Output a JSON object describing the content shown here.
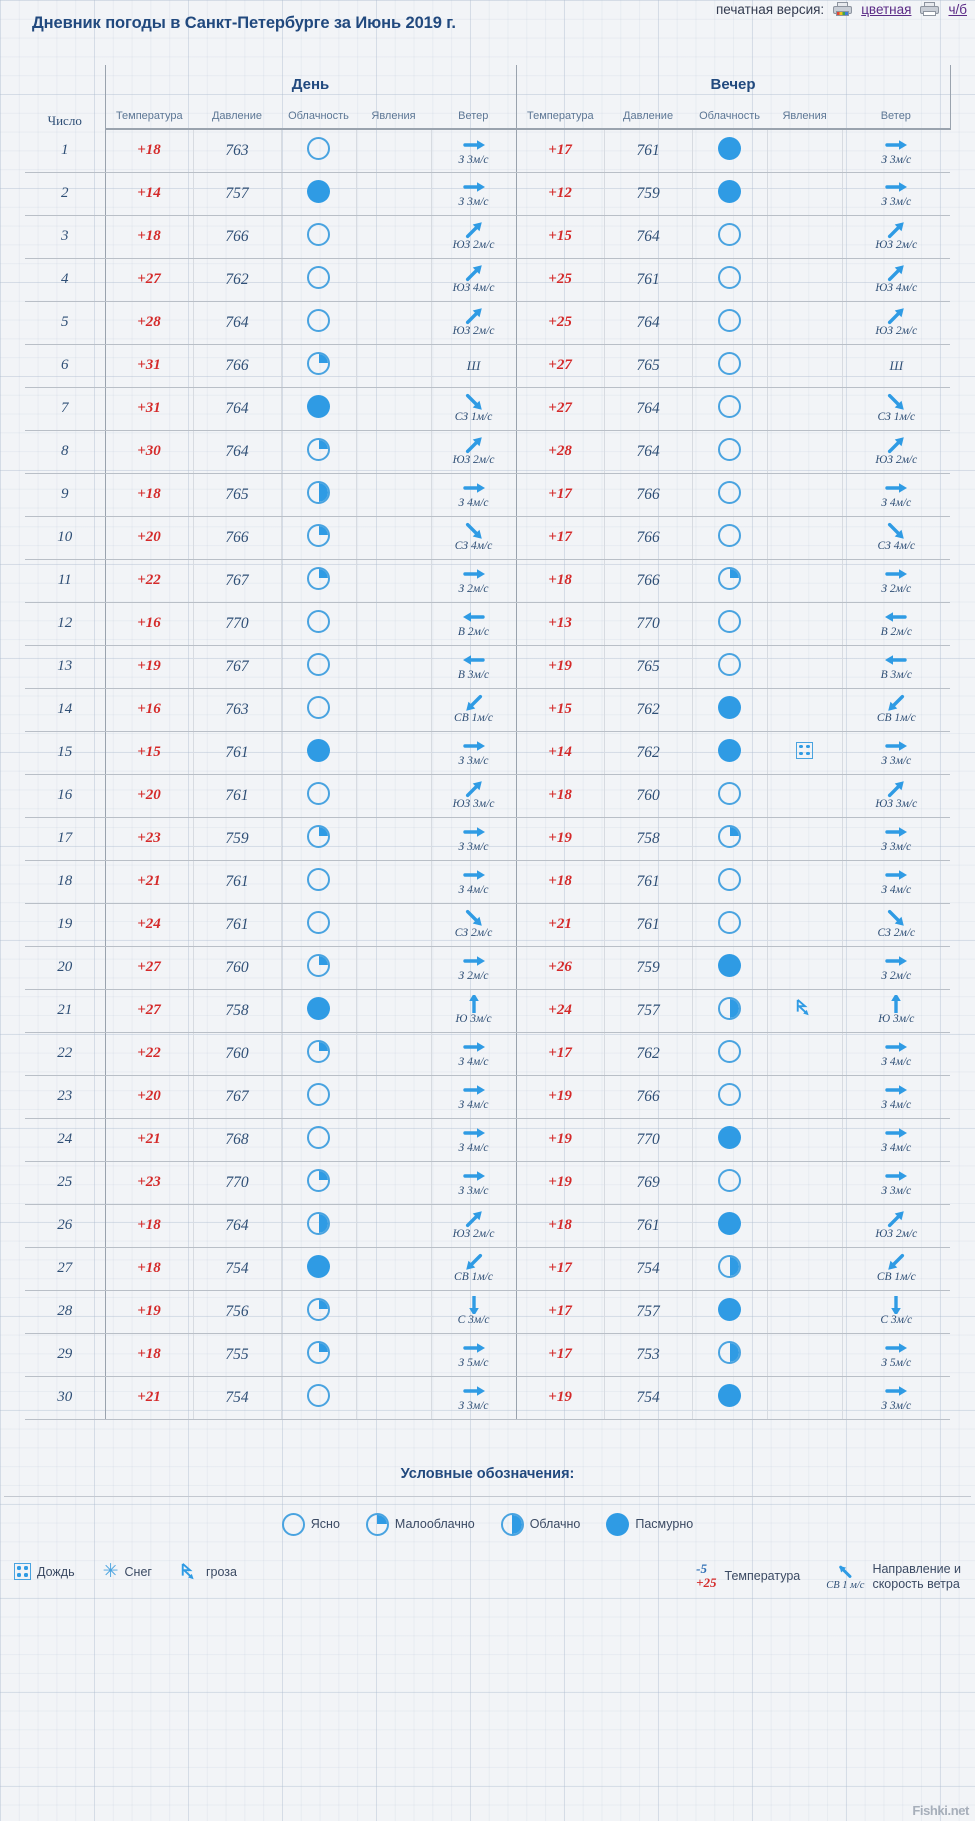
{
  "header": {
    "title": "Дневник погоды в Санкт-Петербурге за Июнь 2019 г.",
    "print_label": "печатная версия:",
    "print_color": "цветная",
    "print_bw": "ч/б"
  },
  "table": {
    "corner": "Число",
    "groups": [
      "День",
      "Вечер"
    ],
    "subheaders": [
      "Температура",
      "Давление",
      "Облачность",
      "Явления",
      "Ветер"
    ],
    "rows": [
      {
        "day": "1",
        "d": {
          "t": "+18",
          "p": "763",
          "cloud": "clear",
          "ph": "",
          "wd": "З",
          "ws": "3",
          "wdir": "E"
        },
        "e": {
          "t": "+17",
          "p": "761",
          "cloud": "overcast",
          "ph": "",
          "wd": "З",
          "ws": "3",
          "wdir": "E"
        }
      },
      {
        "day": "2",
        "d": {
          "t": "+14",
          "p": "757",
          "cloud": "overcast",
          "ph": "",
          "wd": "З",
          "ws": "3",
          "wdir": "E"
        },
        "e": {
          "t": "+12",
          "p": "759",
          "cloud": "overcast",
          "ph": "",
          "wd": "З",
          "ws": "3",
          "wdir": "E"
        }
      },
      {
        "day": "3",
        "d": {
          "t": "+18",
          "p": "766",
          "cloud": "clear",
          "ph": "",
          "wd": "ЮЗ",
          "ws": "2",
          "wdir": "NE"
        },
        "e": {
          "t": "+15",
          "p": "764",
          "cloud": "clear",
          "ph": "",
          "wd": "ЮЗ",
          "ws": "2",
          "wdir": "NE"
        }
      },
      {
        "day": "4",
        "d": {
          "t": "+27",
          "p": "762",
          "cloud": "clear",
          "ph": "",
          "wd": "ЮЗ",
          "ws": "4",
          "wdir": "NE"
        },
        "e": {
          "t": "+25",
          "p": "761",
          "cloud": "clear",
          "ph": "",
          "wd": "ЮЗ",
          "ws": "4",
          "wdir": "NE"
        }
      },
      {
        "day": "5",
        "d": {
          "t": "+28",
          "p": "764",
          "cloud": "clear",
          "ph": "",
          "wd": "ЮЗ",
          "ws": "2",
          "wdir": "NE"
        },
        "e": {
          "t": "+25",
          "p": "764",
          "cloud": "clear",
          "ph": "",
          "wd": "ЮЗ",
          "ws": "2",
          "wdir": "NE"
        }
      },
      {
        "day": "6",
        "d": {
          "t": "+31",
          "p": "766",
          "cloud": "partly",
          "ph": "",
          "wd": "",
          "ws": "",
          "wdir": "calm"
        },
        "e": {
          "t": "+27",
          "p": "765",
          "cloud": "clear",
          "ph": "",
          "wd": "",
          "ws": "",
          "wdir": "calm"
        }
      },
      {
        "day": "7",
        "d": {
          "t": "+31",
          "p": "764",
          "cloud": "overcast",
          "ph": "",
          "wd": "СЗ",
          "ws": "1",
          "wdir": "SE"
        },
        "e": {
          "t": "+27",
          "p": "764",
          "cloud": "clear",
          "ph": "",
          "wd": "СЗ",
          "ws": "1",
          "wdir": "SE"
        }
      },
      {
        "day": "8",
        "d": {
          "t": "+30",
          "p": "764",
          "cloud": "partly",
          "ph": "",
          "wd": "ЮЗ",
          "ws": "2",
          "wdir": "NE"
        },
        "e": {
          "t": "+28",
          "p": "764",
          "cloud": "clear",
          "ph": "",
          "wd": "ЮЗ",
          "ws": "2",
          "wdir": "NE"
        }
      },
      {
        "day": "9",
        "d": {
          "t": "+18",
          "p": "765",
          "cloud": "cloudy",
          "ph": "",
          "wd": "З",
          "ws": "4",
          "wdir": "E"
        },
        "e": {
          "t": "+17",
          "p": "766",
          "cloud": "clear",
          "ph": "",
          "wd": "З",
          "ws": "4",
          "wdir": "E"
        }
      },
      {
        "day": "10",
        "d": {
          "t": "+20",
          "p": "766",
          "cloud": "partly",
          "ph": "",
          "wd": "СЗ",
          "ws": "4",
          "wdir": "SE"
        },
        "e": {
          "t": "+17",
          "p": "766",
          "cloud": "clear",
          "ph": "",
          "wd": "СЗ",
          "ws": "4",
          "wdir": "SE"
        }
      },
      {
        "day": "11",
        "d": {
          "t": "+22",
          "p": "767",
          "cloud": "partly",
          "ph": "",
          "wd": "З",
          "ws": "2",
          "wdir": "E"
        },
        "e": {
          "t": "+18",
          "p": "766",
          "cloud": "partly",
          "ph": "",
          "wd": "З",
          "ws": "2",
          "wdir": "E"
        }
      },
      {
        "day": "12",
        "d": {
          "t": "+16",
          "p": "770",
          "cloud": "clear",
          "ph": "",
          "wd": "В",
          "ws": "2",
          "wdir": "W"
        },
        "e": {
          "t": "+13",
          "p": "770",
          "cloud": "clear",
          "ph": "",
          "wd": "В",
          "ws": "2",
          "wdir": "W"
        }
      },
      {
        "day": "13",
        "d": {
          "t": "+19",
          "p": "767",
          "cloud": "clear",
          "ph": "",
          "wd": "В",
          "ws": "3",
          "wdir": "W"
        },
        "e": {
          "t": "+19",
          "p": "765",
          "cloud": "clear",
          "ph": "",
          "wd": "В",
          "ws": "3",
          "wdir": "W"
        }
      },
      {
        "day": "14",
        "d": {
          "t": "+16",
          "p": "763",
          "cloud": "clear",
          "ph": "",
          "wd": "СВ",
          "ws": "1",
          "wdir": "SW"
        },
        "e": {
          "t": "+15",
          "p": "762",
          "cloud": "overcast",
          "ph": "",
          "wd": "СВ",
          "ws": "1",
          "wdir": "SW"
        }
      },
      {
        "day": "15",
        "d": {
          "t": "+15",
          "p": "761",
          "cloud": "overcast",
          "ph": "",
          "wd": "З",
          "ws": "3",
          "wdir": "E"
        },
        "e": {
          "t": "+14",
          "p": "762",
          "cloud": "overcast",
          "ph": "rain",
          "wd": "З",
          "ws": "3",
          "wdir": "E"
        }
      },
      {
        "day": "16",
        "d": {
          "t": "+20",
          "p": "761",
          "cloud": "clear",
          "ph": "",
          "wd": "ЮЗ",
          "ws": "3",
          "wdir": "NE"
        },
        "e": {
          "t": "+18",
          "p": "760",
          "cloud": "clear",
          "ph": "",
          "wd": "ЮЗ",
          "ws": "3",
          "wdir": "NE"
        }
      },
      {
        "day": "17",
        "d": {
          "t": "+23",
          "p": "759",
          "cloud": "partly",
          "ph": "",
          "wd": "З",
          "ws": "3",
          "wdir": "E"
        },
        "e": {
          "t": "+19",
          "p": "758",
          "cloud": "partly",
          "ph": "",
          "wd": "З",
          "ws": "3",
          "wdir": "E"
        }
      },
      {
        "day": "18",
        "d": {
          "t": "+21",
          "p": "761",
          "cloud": "clear",
          "ph": "",
          "wd": "З",
          "ws": "4",
          "wdir": "E"
        },
        "e": {
          "t": "+18",
          "p": "761",
          "cloud": "clear",
          "ph": "",
          "wd": "З",
          "ws": "4",
          "wdir": "E"
        }
      },
      {
        "day": "19",
        "d": {
          "t": "+24",
          "p": "761",
          "cloud": "clear",
          "ph": "",
          "wd": "СЗ",
          "ws": "2",
          "wdir": "SE"
        },
        "e": {
          "t": "+21",
          "p": "761",
          "cloud": "clear",
          "ph": "",
          "wd": "СЗ",
          "ws": "2",
          "wdir": "SE"
        }
      },
      {
        "day": "20",
        "d": {
          "t": "+27",
          "p": "760",
          "cloud": "partly",
          "ph": "",
          "wd": "З",
          "ws": "2",
          "wdir": "E"
        },
        "e": {
          "t": "+26",
          "p": "759",
          "cloud": "overcast",
          "ph": "",
          "wd": "З",
          "ws": "2",
          "wdir": "E"
        }
      },
      {
        "day": "21",
        "d": {
          "t": "+27",
          "p": "758",
          "cloud": "overcast",
          "ph": "",
          "wd": "Ю",
          "ws": "3",
          "wdir": "N"
        },
        "e": {
          "t": "+24",
          "p": "757",
          "cloud": "cloudy",
          "ph": "storm",
          "wd": "Ю",
          "ws": "3",
          "wdir": "N"
        }
      },
      {
        "day": "22",
        "d": {
          "t": "+22",
          "p": "760",
          "cloud": "partly",
          "ph": "",
          "wd": "З",
          "ws": "4",
          "wdir": "E"
        },
        "e": {
          "t": "+17",
          "p": "762",
          "cloud": "clear",
          "ph": "",
          "wd": "З",
          "ws": "4",
          "wdir": "E"
        }
      },
      {
        "day": "23",
        "d": {
          "t": "+20",
          "p": "767",
          "cloud": "clear",
          "ph": "",
          "wd": "З",
          "ws": "4",
          "wdir": "E"
        },
        "e": {
          "t": "+19",
          "p": "766",
          "cloud": "clear",
          "ph": "",
          "wd": "З",
          "ws": "4",
          "wdir": "E"
        }
      },
      {
        "day": "24",
        "d": {
          "t": "+21",
          "p": "768",
          "cloud": "clear",
          "ph": "",
          "wd": "З",
          "ws": "4",
          "wdir": "E"
        },
        "e": {
          "t": "+19",
          "p": "770",
          "cloud": "overcast",
          "ph": "",
          "wd": "З",
          "ws": "4",
          "wdir": "E"
        }
      },
      {
        "day": "25",
        "d": {
          "t": "+23",
          "p": "770",
          "cloud": "partly",
          "ph": "",
          "wd": "З",
          "ws": "3",
          "wdir": "E"
        },
        "e": {
          "t": "+19",
          "p": "769",
          "cloud": "clear",
          "ph": "",
          "wd": "З",
          "ws": "3",
          "wdir": "E"
        }
      },
      {
        "day": "26",
        "d": {
          "t": "+18",
          "p": "764",
          "cloud": "cloudy",
          "ph": "",
          "wd": "ЮЗ",
          "ws": "2",
          "wdir": "NE"
        },
        "e": {
          "t": "+18",
          "p": "761",
          "cloud": "overcast",
          "ph": "",
          "wd": "ЮЗ",
          "ws": "2",
          "wdir": "NE"
        }
      },
      {
        "day": "27",
        "d": {
          "t": "+18",
          "p": "754",
          "cloud": "overcast",
          "ph": "",
          "wd": "СВ",
          "ws": "1",
          "wdir": "SW"
        },
        "e": {
          "t": "+17",
          "p": "754",
          "cloud": "cloudy",
          "ph": "",
          "wd": "СВ",
          "ws": "1",
          "wdir": "SW"
        }
      },
      {
        "day": "28",
        "d": {
          "t": "+19",
          "p": "756",
          "cloud": "partly",
          "ph": "",
          "wd": "С",
          "ws": "3",
          "wdir": "S"
        },
        "e": {
          "t": "+17",
          "p": "757",
          "cloud": "overcast",
          "ph": "",
          "wd": "С",
          "ws": "3",
          "wdir": "S"
        }
      },
      {
        "day": "29",
        "d": {
          "t": "+18",
          "p": "755",
          "cloud": "partly",
          "ph": "",
          "wd": "З",
          "ws": "5",
          "wdir": "E"
        },
        "e": {
          "t": "+17",
          "p": "753",
          "cloud": "cloudy",
          "ph": "",
          "wd": "З",
          "ws": "5",
          "wdir": "E"
        }
      },
      {
        "day": "30",
        "d": {
          "t": "+21",
          "p": "754",
          "cloud": "clear",
          "ph": "",
          "wd": "З",
          "ws": "3",
          "wdir": "E"
        },
        "e": {
          "t": "+19",
          "p": "754",
          "cloud": "overcast",
          "ph": "",
          "wd": "З",
          "ws": "3",
          "wdir": "E"
        }
      }
    ]
  },
  "legend": {
    "title": "Условные обозначения:",
    "cloud_items": [
      {
        "key": "clear",
        "label": "Ясно"
      },
      {
        "key": "partly",
        "label": "Малооблачно"
      },
      {
        "key": "cloudy",
        "label": "Облачно"
      },
      {
        "key": "overcast",
        "label": "Пасмурно"
      }
    ],
    "phenomena": [
      {
        "key": "rain",
        "label": "Дождь"
      },
      {
        "key": "snow",
        "label": "Снег"
      },
      {
        "key": "storm",
        "label": "гроза"
      }
    ],
    "temp_key": {
      "cold": "-5",
      "hot": "+25",
      "label": "Температура"
    },
    "wind_key": {
      "dir": "СВ",
      "speed": "1",
      "unit": "м/с",
      "label_line1": "Направление и",
      "label_line2": "скорость ветра"
    }
  },
  "units": {
    "speed": "м/с"
  },
  "watermark": "Fishki.net",
  "colors": {
    "accent": "#2f9be4",
    "heading": "#21497e",
    "temp": "#d42a2a",
    "press": "#2f4f76"
  }
}
